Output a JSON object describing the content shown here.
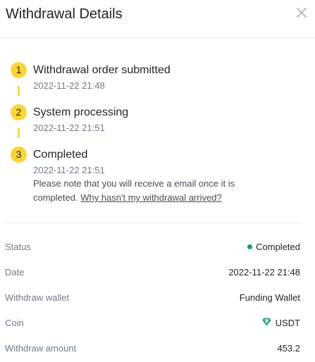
{
  "header": {
    "title": "Withdrawal Details"
  },
  "steps": [
    {
      "num": "1",
      "title": "Withdrawal order submitted",
      "time": "2022-11-22 21:48"
    },
    {
      "num": "2",
      "title": "System processing",
      "time": "2022-11-22 21:51"
    },
    {
      "num": "3",
      "title": "Completed",
      "time": "2022-11-22 21:51",
      "note": "Please note that you will receive a email once it is completed.",
      "link": "Why hasn't my withdrawal arrived?"
    }
  ],
  "colors": {
    "accent": "#fcd535",
    "success": "#03a66d",
    "coin": "#26a17b"
  },
  "details": {
    "status": {
      "label": "Status",
      "value": "Completed"
    },
    "date": {
      "label": "Date",
      "value": "2022-11-22 21:48"
    },
    "wallet": {
      "label": "Withdraw wallet",
      "value": "Funding Wallet"
    },
    "coin": {
      "label": "Coin",
      "value": "USDT",
      "icon": "tether-icon"
    },
    "amount": {
      "label": "Withdraw amount",
      "value": "453.2"
    }
  }
}
